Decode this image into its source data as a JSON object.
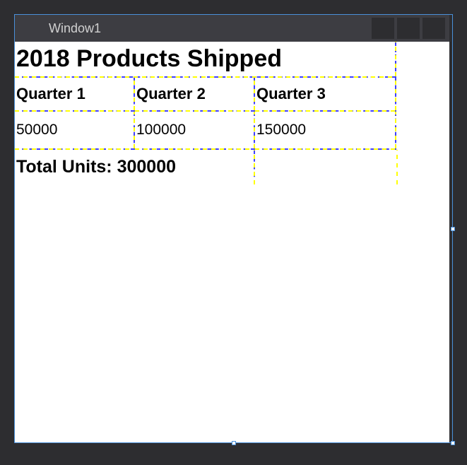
{
  "window": {
    "title": "Window1"
  },
  "heading": "2018 Products Shipped",
  "columns": {
    "c1": "Quarter 1",
    "c2": "Quarter 2",
    "c3": "Quarter 3"
  },
  "values": {
    "v1": "50000",
    "v2": "100000",
    "v3": "150000"
  },
  "total": "Total Units: 300000"
}
